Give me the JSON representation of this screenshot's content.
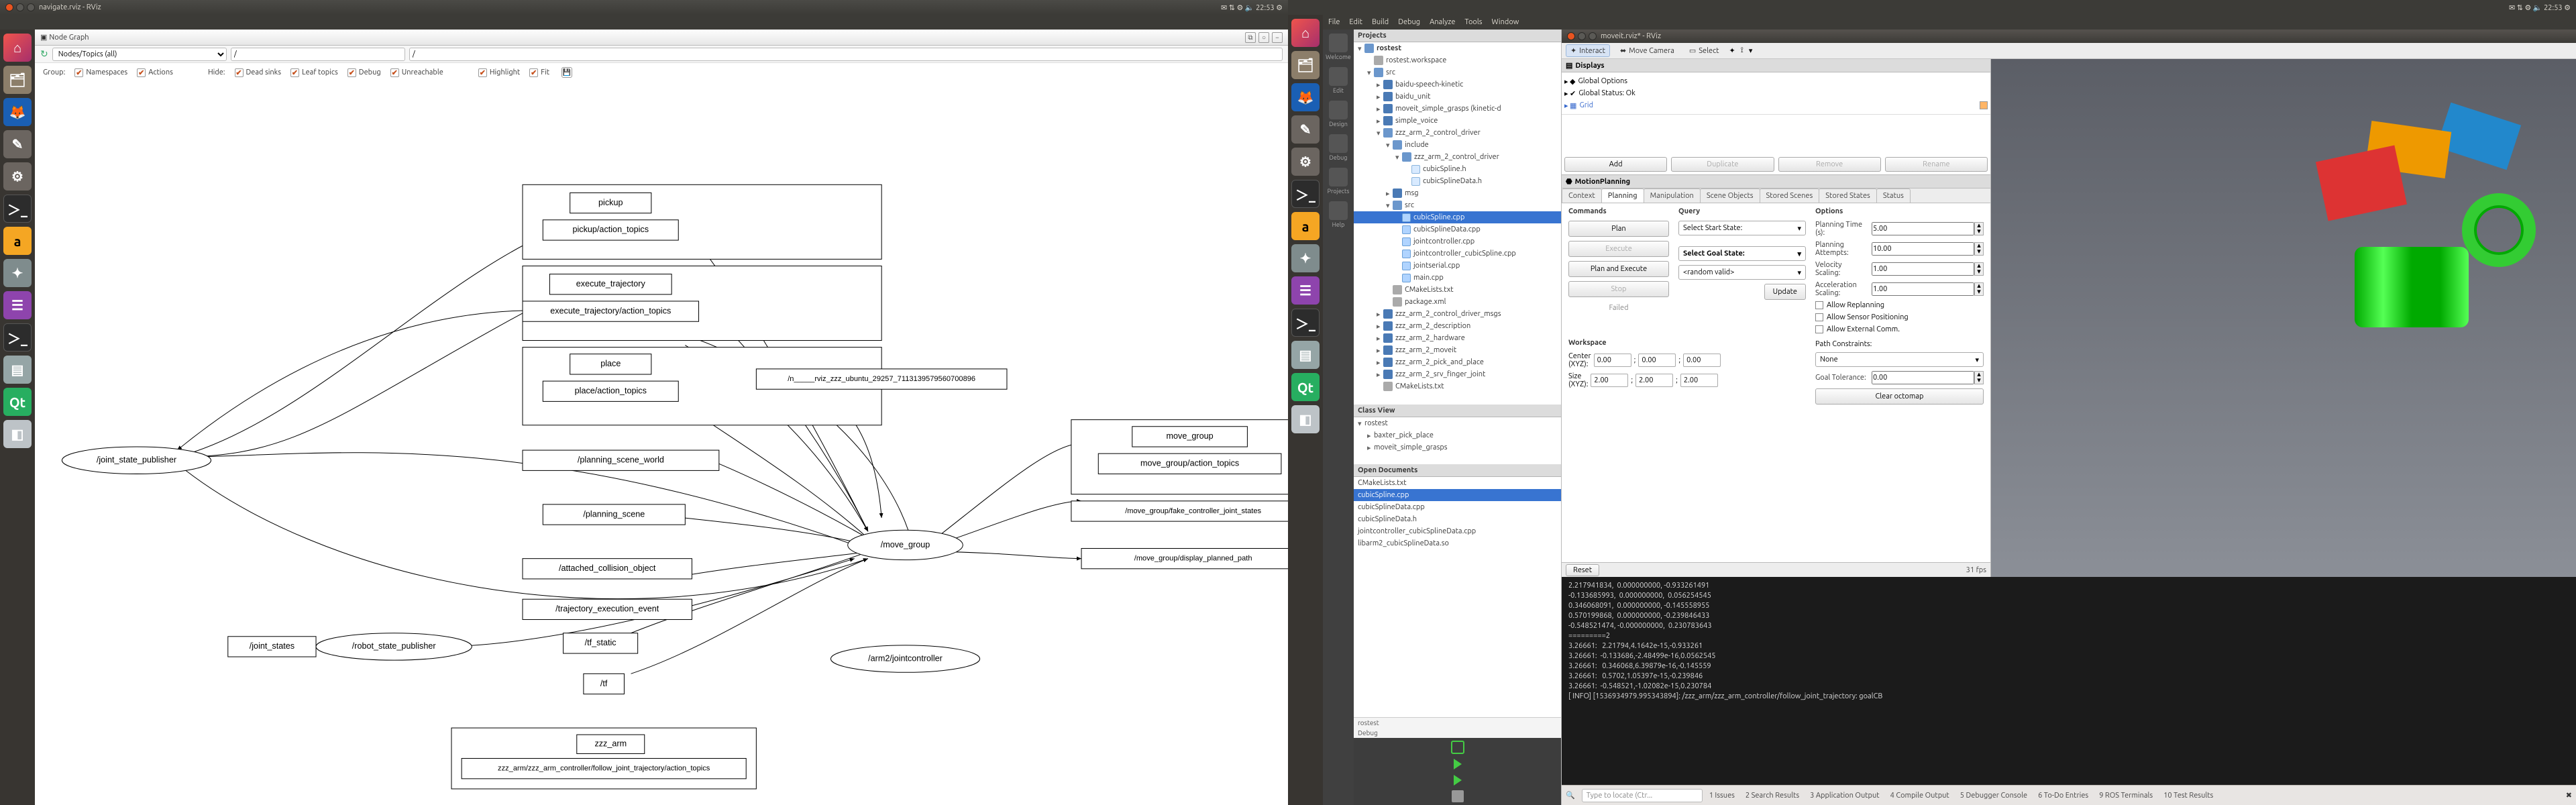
{
  "screen1": {
    "titlebar": "navigate.rviz - RViz",
    "topbar_right": "✉  ⇅  ⚙  🔈  22:53  ⚙",
    "node_graph_hdr": "Node Graph",
    "toolbar": {
      "refresh_icon": "↻",
      "dropdown": "Nodes/Topics (all)",
      "input1": "/",
      "input2": "/"
    },
    "filter_row": {
      "group_label": "Group:",
      "namespaces": "Namespaces",
      "actions": "Actions",
      "hide_label": "Hide:",
      "dead_sinks": "Dead sinks",
      "leaf_topics": "Leaf topics",
      "debug": "Debug",
      "unreachable": "Unreachable",
      "highlight": "Highlight",
      "fit": "Fit"
    },
    "graph": {
      "joint_state_publisher": "/joint_state_publisher",
      "joint_states": "/joint_states",
      "robot_state_publisher": "/robot_state_publisher",
      "pickup": "pickup",
      "pickup_at": "pickup/action_topics",
      "execute_trajectory": "execute_trajectory",
      "execute_trajectory_at": "execute_trajectory/action_topics",
      "place": "place",
      "place_at": "place/action_topics",
      "planning_scene_world": "/planning_scene_world",
      "planning_scene": "/planning_scene",
      "attached_collision": "/attached_collision_object",
      "trajectory_exec": "/trajectory_execution_event",
      "tf_static": "/tf_static",
      "tf": "/tf",
      "arm2_jointcontroller": "/arm2/jointcontroller",
      "rviz_node": "/n_____rviz_zzz_ubuntu_29257_7113139579560700896",
      "move_group": "/move_group",
      "move_group_box": "move_group",
      "move_group_at": "move_group/action_topics",
      "fake_controller": "/move_group/fake_controller_joint_states",
      "display_planned": "/move_group/display_planned_path",
      "zzz_arm": "zzz_arm",
      "zzz_arm_at": "zzz_arm/zzz_arm_controller/follow_joint_trajectory/action_topics"
    }
  },
  "screen2": {
    "topbar_right": "✉  ⇅  ⚙  🔈  22:53  ⚙",
    "menus": [
      "File",
      "Edit",
      "Build",
      "Debug",
      "Analyze",
      "Tools",
      "Window"
    ],
    "iconbar": [
      {
        "label": "Welcome"
      },
      {
        "label": "Edit"
      },
      {
        "label": "Design"
      },
      {
        "label": "Debug"
      },
      {
        "label": "Projects"
      },
      {
        "label": "Help"
      }
    ],
    "projects_title": "Projects",
    "tree": [
      {
        "d": 0,
        "t": "rostest",
        "i": "folder-o",
        "a": "▾",
        "bold": true
      },
      {
        "d": 1,
        "t": "rostest.workspace",
        "i": "file",
        "a": ""
      },
      {
        "d": 1,
        "t": "src",
        "i": "folder-o",
        "a": "▾"
      },
      {
        "d": 2,
        "t": "baidu-speech-kinetic",
        "i": "folder",
        "a": "▸"
      },
      {
        "d": 2,
        "t": "baidu_unit",
        "i": "folder",
        "a": "▸"
      },
      {
        "d": 2,
        "t": "moveit_simple_grasps (kinetic-d",
        "i": "folder",
        "a": "▸"
      },
      {
        "d": 2,
        "t": "simple_voice",
        "i": "folder",
        "a": "▸"
      },
      {
        "d": 2,
        "t": "zzz_arm_2_control_driver",
        "i": "folder-o",
        "a": "▾"
      },
      {
        "d": 3,
        "t": "include",
        "i": "folder-o",
        "a": "▾"
      },
      {
        "d": 4,
        "t": "zzz_arm_2_control_driver",
        "i": "folder-o",
        "a": "▾"
      },
      {
        "d": 5,
        "t": "cubicSpline.h",
        "i": "h",
        "a": ""
      },
      {
        "d": 5,
        "t": "cubicSplineData.h",
        "i": "h",
        "a": ""
      },
      {
        "d": 3,
        "t": "msg",
        "i": "folder",
        "a": "▸"
      },
      {
        "d": 3,
        "t": "src",
        "i": "folder-o",
        "a": "▾"
      },
      {
        "d": 4,
        "t": "cubicSpline.cpp",
        "i": "cpp",
        "a": "",
        "sel": true
      },
      {
        "d": 4,
        "t": "cubicSplineData.cpp",
        "i": "cpp",
        "a": ""
      },
      {
        "d": 4,
        "t": "jointcontroller.cpp",
        "i": "cpp",
        "a": ""
      },
      {
        "d": 4,
        "t": "jointcontroller_cubicSpline.cpp",
        "i": "cpp",
        "a": ""
      },
      {
        "d": 4,
        "t": "jointserial.cpp",
        "i": "cpp",
        "a": ""
      },
      {
        "d": 4,
        "t": "main.cpp",
        "i": "cpp",
        "a": ""
      },
      {
        "d": 3,
        "t": "CMakeLists.txt",
        "i": "file",
        "a": ""
      },
      {
        "d": 3,
        "t": "package.xml",
        "i": "file",
        "a": ""
      },
      {
        "d": 2,
        "t": "zzz_arm_2_control_driver_msgs",
        "i": "folder",
        "a": "▸"
      },
      {
        "d": 2,
        "t": "zzz_arm_2_description",
        "i": "folder",
        "a": "▸"
      },
      {
        "d": 2,
        "t": "zzz_arm_2_hardware",
        "i": "folder",
        "a": "▸"
      },
      {
        "d": 2,
        "t": "zzz_arm_2_moveit",
        "i": "folder",
        "a": "▸"
      },
      {
        "d": 2,
        "t": "zzz_arm_2_pick_and_place",
        "i": "folder",
        "a": "▸"
      },
      {
        "d": 2,
        "t": "zzz_arm_2_srv_finger_joint",
        "i": "folder",
        "a": "▸"
      },
      {
        "d": 2,
        "t": "CMakeLists.txt",
        "i": "file",
        "a": ""
      }
    ],
    "class_view_title": "Class View",
    "class_view": [
      {
        "d": 0,
        "t": "rostest",
        "a": "▾"
      },
      {
        "d": 1,
        "t": "baxter_pick_place",
        "a": "▸"
      },
      {
        "d": 1,
        "t": "moveit_simple_grasps",
        "a": "▸"
      }
    ],
    "open_docs_title": "Open Documents",
    "open_docs": [
      {
        "t": "CMakeLists.txt"
      },
      {
        "t": "cubicSpline.cpp",
        "sel": true
      },
      {
        "t": "cubicSplineData.cpp"
      },
      {
        "t": "cubicSplineData.h"
      },
      {
        "t": "jointcontroller_cubicSplineData.cpp"
      },
      {
        "t": "libarm2_cubicSplineData.so"
      }
    ],
    "side_labels": [
      "rostest",
      "Debug"
    ],
    "rviz": {
      "title": "moveit.rviz* - RViz",
      "toolbar": {
        "interact": "Interact",
        "move": "Move Camera",
        "select": "Select"
      },
      "displays_title": "Displays",
      "displays": {
        "global_options": "Global Options",
        "global_status": "Global Status: Ok",
        "grid": "Grid"
      },
      "btns": {
        "add": "Add",
        "duplicate": "Duplicate",
        "remove": "Remove",
        "rename": "Rename"
      },
      "mp_title": "MotionPlanning",
      "tabs": [
        "Context",
        "Planning",
        "Manipulation",
        "Scene Objects",
        "Stored Scenes",
        "Stored States",
        "Status"
      ],
      "active_tab": 1,
      "commands_h": "Commands",
      "query_h": "Query",
      "options_h": "Options",
      "workspace_h": "Workspace",
      "btn_plan": "Plan",
      "btn_execute": "Execute",
      "btn_plan_exec": "Plan and Execute",
      "btn_stop": "Stop",
      "failed": "Failed",
      "select_start": "Select Start State:",
      "select_goal": "Select Goal State:",
      "random_valid": "<random valid>",
      "btn_update": "Update",
      "planning_time": "Planning Time (s):",
      "planning_time_v": "5.00",
      "planning_attempts": "Planning Attempts:",
      "planning_attempts_v": "10.00",
      "vel_scaling": "Velocity Scaling:",
      "vel_scaling_v": "1.00",
      "acc_scaling": "Acceleration Scaling:",
      "acc_scaling_v": "1.00",
      "allow_replanning": "Allow Replanning",
      "allow_sensor": "Allow Sensor Positioning",
      "allow_external": "Allow External Comm.",
      "path_constraints": "Path Constraints:",
      "path_constraints_v": "None",
      "goal_tolerance": "Goal Tolerance:",
      "goal_tolerance_v": "0.00",
      "clear_octomap": "Clear octomap",
      "center_xyz": "Center (XYZ):",
      "size_xyz": "Size (XYZ):",
      "center_v": [
        "0.00",
        "0.00",
        "0.00"
      ],
      "size_v": [
        "2.00",
        "2.00",
        "2.00"
      ],
      "reset": "Reset",
      "fps": "31 fps"
    },
    "terminal_lines": [
      "2.217941834,  0.000000000, -0.933261491",
      "-0.133685993,  0.000000000,  0.056254545",
      "0.346068091,  0.000000000, -0.145558955",
      "0.570199868,  0.000000000, -0.239846433",
      "-0.548521474, -0.000000000,  0.230783643",
      "=========2",
      "3.26661:   2.21794,4.1642e-15,-0.933261",
      "3.26661:  -0.133686,-2.48499e-16,0.0562545",
      "3.26661:   0.346068,6.39879e-16,-0.145559",
      "3.26661:   0.5702,1.05397e-15,-0.239846",
      "3.26661:  -0.548521,-1.02082e-15,0.230784",
      "[ INFO] [1536934979.995343894]: /zzz_arm/zzz_arm_controller/follow_joint_trajectory: goalCB"
    ],
    "statusbar": {
      "search_placeholder": "Type to locate (Ctr...",
      "items": [
        "1  Issues",
        "2  Search Results",
        "3  Application Output",
        "4  Compile Output",
        "5  Debugger Console",
        "6  To-Do Entries",
        "9  ROS Terminals",
        "10 Test Results"
      ]
    }
  }
}
